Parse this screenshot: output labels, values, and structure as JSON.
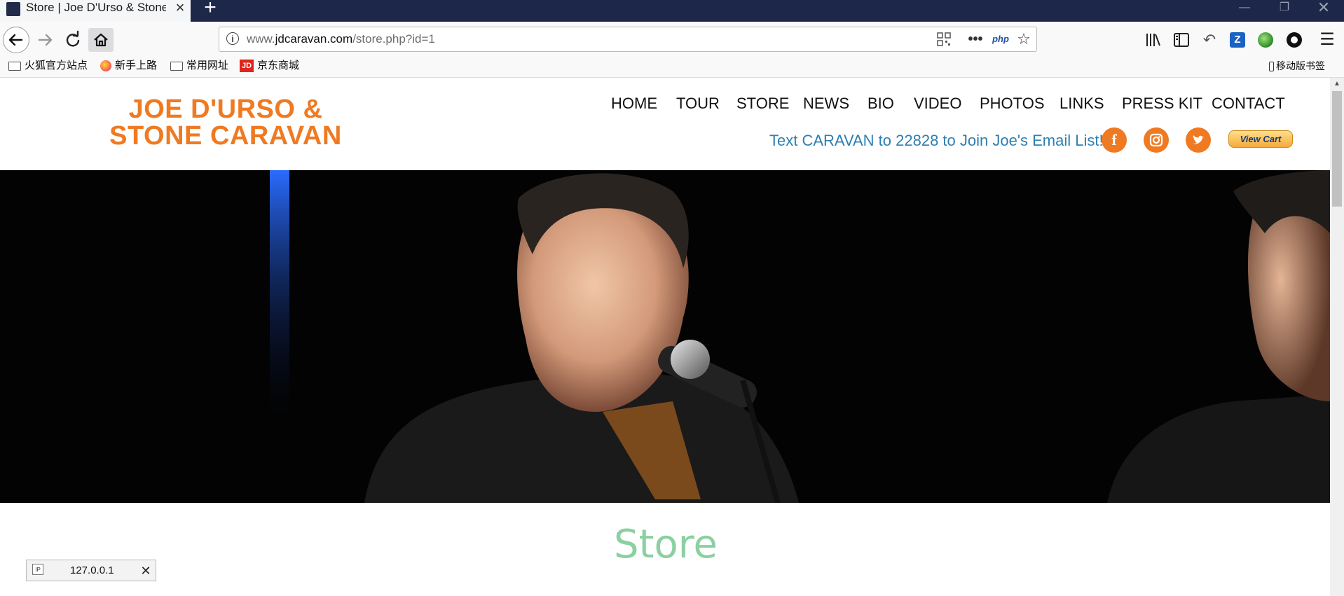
{
  "browser": {
    "tab_title": "Store | Joe D'Urso & Stone C",
    "url_prefix": "www.",
    "url_domain": "jdcaravan.com",
    "url_path": "/store.php?id=1",
    "php_label": "php",
    "bookmarks": [
      "火狐官方站点",
      "新手上路",
      "常用网址",
      "京东商城"
    ],
    "jd_badge": "JD",
    "mobile_bookmarks": "移动版书签"
  },
  "site": {
    "logo": "JOE D'URSO & STONE CARAVAN",
    "menu": [
      "HOME",
      "TOUR",
      "STORE",
      "NEWS",
      "BIO",
      "VIDEO",
      "PHOTOS",
      "LINKS",
      "PRESS KIT",
      "CONTACT"
    ],
    "promo": "Text CARAVAN to 22828 to Join Joe's Email List!",
    "view_cart": "View Cart",
    "heading": "Store",
    "brand_color": "#ef7a22",
    "heading_color": "#8cd0a1"
  },
  "status": {
    "text": "127.0.0.1"
  }
}
